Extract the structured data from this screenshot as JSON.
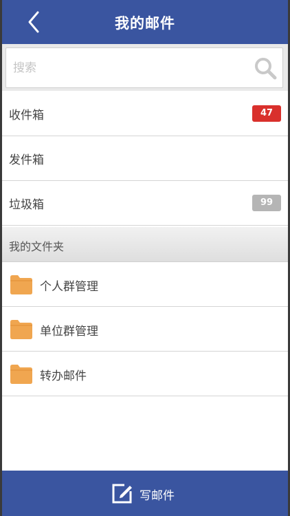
{
  "header": {
    "title": "我的邮件",
    "back_icon": "chevron-left-icon"
  },
  "search": {
    "placeholder": "搜索",
    "value": "",
    "icon": "search-icon"
  },
  "mailboxes": [
    {
      "label": "收件箱",
      "badge": "47",
      "badge_color": "#d9302c"
    },
    {
      "label": "发件箱",
      "badge": "",
      "badge_color": ""
    },
    {
      "label": "垃圾箱",
      "badge": "99",
      "badge_color": "#b5b5b5"
    }
  ],
  "folders_section": {
    "title": "我的文件夹",
    "folder_color": "#f0a650",
    "items": [
      {
        "label": "个人群管理",
        "icon": "folder-icon"
      },
      {
        "label": "单位群管理",
        "icon": "folder-icon"
      },
      {
        "label": "转办邮件",
        "icon": "folder-icon"
      }
    ]
  },
  "footer": {
    "compose_label": "写邮件",
    "compose_icon": "edit-icon"
  },
  "colors": {
    "brand": "#3a55a0",
    "background": "#ffffff",
    "section_bg": "#e6e6e6"
  }
}
